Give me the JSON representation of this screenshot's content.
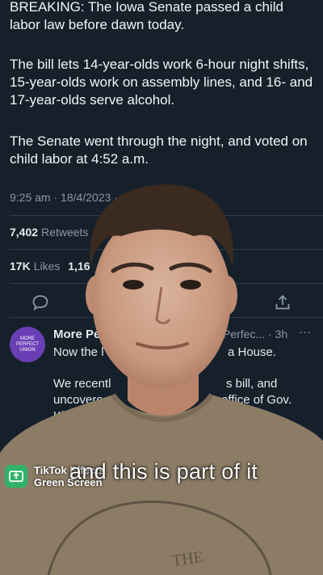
{
  "tweet": {
    "paragraph1": "BREAKING: The Iowa Senate passed a child labor law before dawn today.",
    "paragraph2": "The bill lets 14-year-olds work 6-hour night shifts, 15-year-olds work on assembly lines, and 16- and 17-year-olds serve alcohol.",
    "paragraph3": "The Senate went through the night, and voted on child labor at 4:52 a.m.",
    "timestamp": "9:25 am · 18/4/2023 ·",
    "retweets_count": "7,402",
    "retweets_label": "Retweets",
    "likes_count": "17K",
    "likes_label": "Likes",
    "bookmarks_count": "1,16"
  },
  "reply": {
    "avatar_text": "MORE PERFECT UNION",
    "name": "More Pe",
    "meta": "Perfec... · 3h",
    "more": "···",
    "line1_start": "Now the l",
    "line1_end": "a House.",
    "line2_start": "We recentl",
    "line2_end": "s bill, and",
    "line3_start": "uncovere",
    "line3_end": "office of Gov.",
    "line4_start": "Ki"
  },
  "overlay": {
    "effect_label_line1": "TikTok Effects",
    "effect_label_line2": "Green Screen",
    "caption": "and this is part of it",
    "shirt_text": "THE"
  },
  "colors": {
    "background": "#15202b",
    "text": "#e7e9ea",
    "muted": "#8b98a5",
    "effect_green": "#2fb36a",
    "avatar_purple": "#6a3fb5"
  }
}
